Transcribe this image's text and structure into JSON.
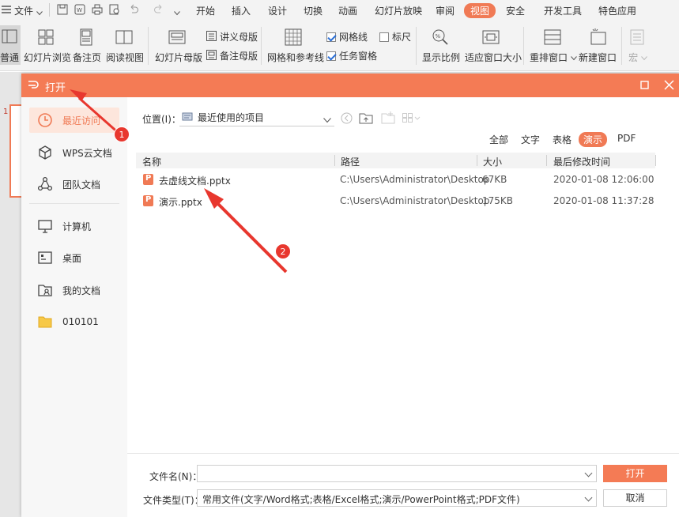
{
  "menubar": {
    "file_label": "文件",
    "tabs": [
      {
        "label": "开始"
      },
      {
        "label": "插入"
      },
      {
        "label": "设计"
      },
      {
        "label": "切换"
      },
      {
        "label": "动画"
      },
      {
        "label": "幻灯片放映"
      },
      {
        "label": "审阅"
      },
      {
        "label": "视图"
      },
      {
        "label": "安全"
      },
      {
        "label": "开发工具"
      },
      {
        "label": "特色应用"
      }
    ],
    "active_tab": "视图",
    "accent": "#f07a55"
  },
  "ribbon": {
    "normal": "普通",
    "slide_sorter": "幻灯片浏览",
    "notes_page": "备注页",
    "reading_view": "阅读视图",
    "slide_master": "幻灯片母版",
    "handout_master": "讲义母版",
    "notes_master": "备注母版",
    "grid_guides": "网格和参考线",
    "gridlines": "网格线",
    "ruler": "标尺",
    "task_pane": "任务窗格",
    "zoom": "显示比例",
    "fit_window": "适应窗口大小",
    "arrange": "重排窗口",
    "new_window": "新建窗口",
    "macro": "宏",
    "checks": {
      "gridlines": true,
      "ruler": false,
      "task_pane": true
    }
  },
  "slide_panel": {
    "slide_number": "1"
  },
  "dialog": {
    "title": "打开",
    "sidebar": [
      {
        "label": "最近访问",
        "icon": "clock-icon",
        "active": true
      },
      {
        "label": "WPS云文档",
        "icon": "cube-icon"
      },
      {
        "label": "团队文档",
        "icon": "team-icon"
      },
      {
        "label": "计算机",
        "icon": "monitor-icon"
      },
      {
        "label": "桌面",
        "icon": "desktop-icon"
      },
      {
        "label": "我的文档",
        "icon": "user-folder-icon"
      },
      {
        "label": "010101",
        "icon": "folder-icon"
      }
    ],
    "location_label": "位置(I)：",
    "location_value": "最近使用的项目",
    "filters": [
      "全部",
      "文字",
      "表格",
      "演示",
      "PDF"
    ],
    "active_filter": "演示",
    "columns": {
      "name": "名称",
      "path": "路径",
      "size": "大小",
      "modified": "最后修改时间"
    },
    "files": [
      {
        "name": "去虚线文档.pptx",
        "path": "C:\\Users\\Administrator\\Desktop",
        "size": "67KB",
        "modified": "2020-01-08 12:06:00"
      },
      {
        "name": "演示.pptx",
        "path": "C:\\Users\\Administrator\\Desktop",
        "size": "175KB",
        "modified": "2020-01-08 11:37:28"
      }
    ],
    "filename_label": "文件名(N)：",
    "filename_value": "",
    "filetype_label": "文件类型(T)：",
    "filetype_value": "常用文件(文字/Word格式;表格/Excel格式;演示/PowerPoint格式;PDF文件)",
    "open_button": "打开",
    "cancel_button": "取消"
  },
  "annotations": {
    "badge1": "1",
    "badge2": "2",
    "arrow_color": "#e8372e"
  }
}
